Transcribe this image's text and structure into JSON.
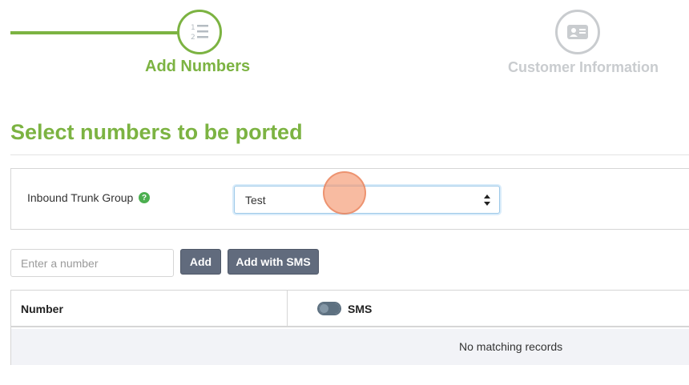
{
  "stepper": {
    "steps": [
      {
        "label": "Add Numbers",
        "icon": "numbered-list-icon",
        "state": "active"
      },
      {
        "label": "Customer Information",
        "icon": "contact-card-icon",
        "state": "inactive"
      }
    ],
    "active_color": "#7cb342",
    "inactive_color": "#c9cccf"
  },
  "page": {
    "title": "Select numbers to be ported"
  },
  "trunk_group": {
    "label": "Inbound Trunk Group",
    "help_icon": "?",
    "selected": "Test"
  },
  "add_row": {
    "input_placeholder": "Enter a number",
    "input_value": "",
    "add_label": "Add",
    "add_sms_label": "Add with SMS"
  },
  "table": {
    "columns": [
      "Number",
      "SMS"
    ],
    "sms_toggle_on": false,
    "empty_message": "No matching records"
  }
}
